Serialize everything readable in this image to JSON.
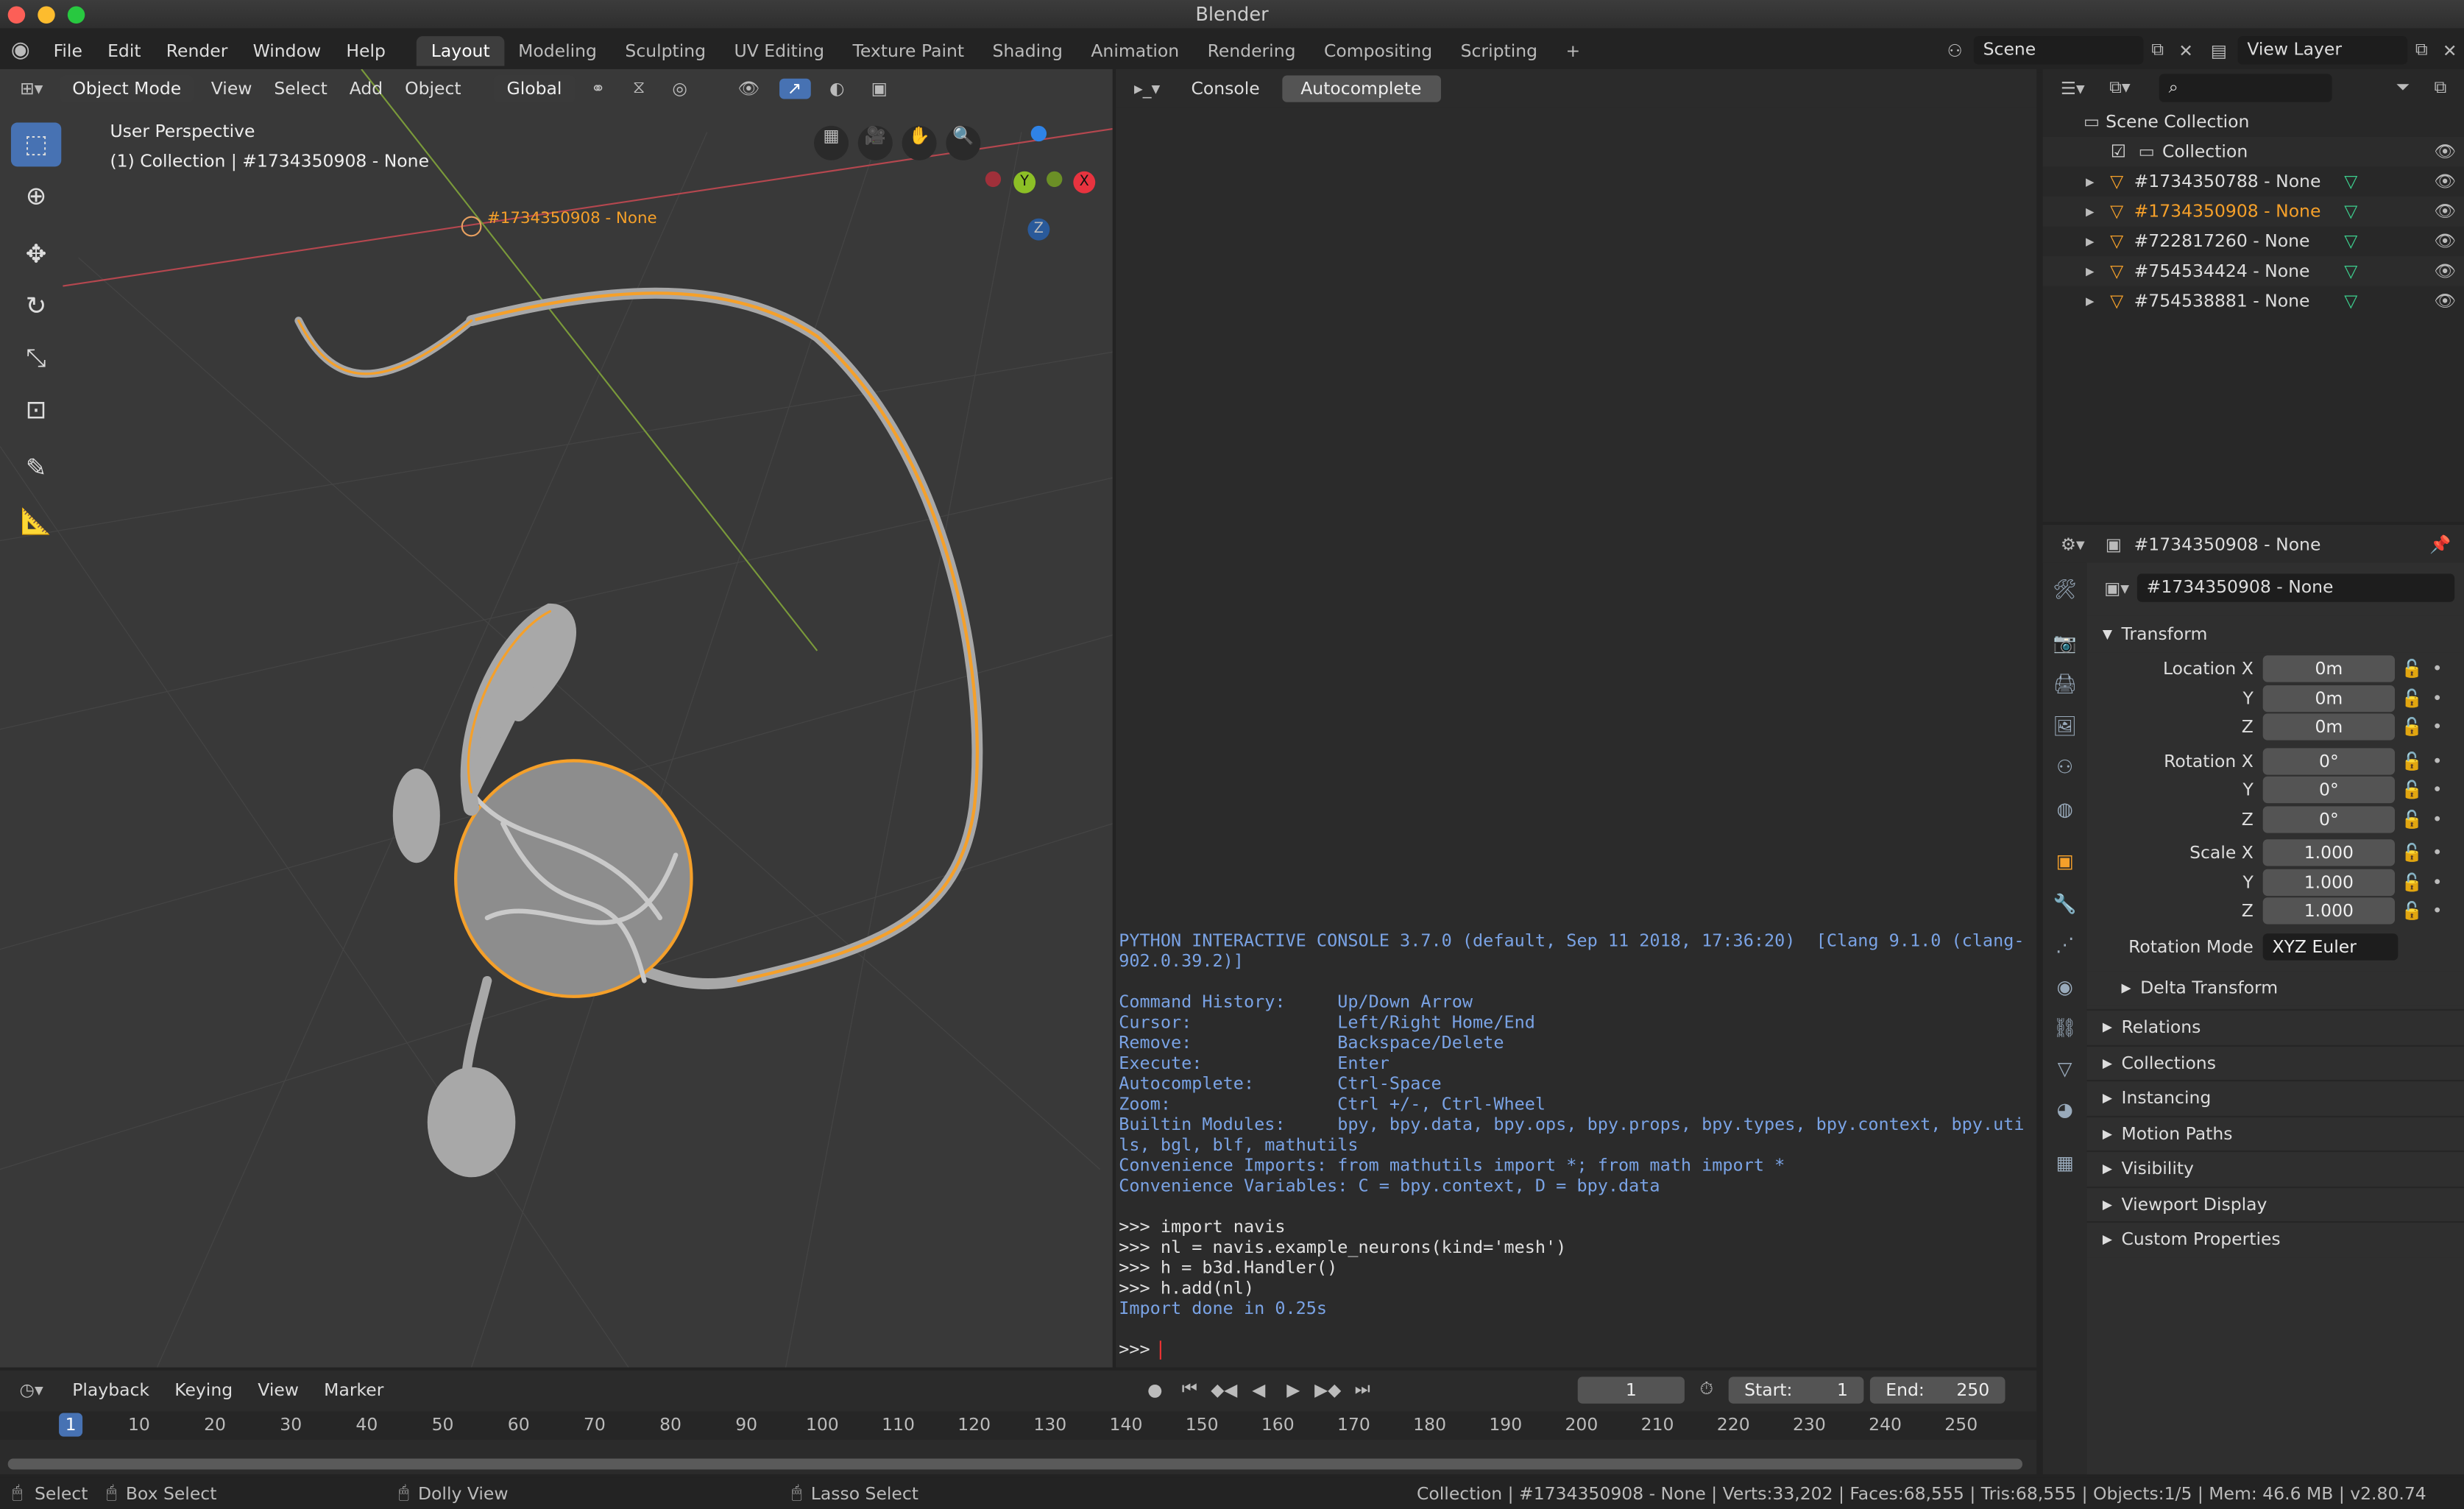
{
  "window": {
    "title": "Blender"
  },
  "menu": [
    "File",
    "Edit",
    "Render",
    "Window",
    "Help"
  ],
  "workspaces": [
    "Layout",
    "Modeling",
    "Sculpting",
    "UV Editing",
    "Texture Paint",
    "Shading",
    "Animation",
    "Rendering",
    "Compositing",
    "Scripting",
    "+"
  ],
  "active_workspace": "Layout",
  "scene": {
    "name": "Scene",
    "view_layer": "View Layer"
  },
  "viewport": {
    "mode": "Object Mode",
    "menus": [
      "View",
      "Select",
      "Add",
      "Object"
    ],
    "orientation": "Global",
    "overlay_title": "User Perspective",
    "overlay_sub": "(1) Collection | #1734350908 - None",
    "object_label": "#1734350908 - None",
    "gizmo": {
      "x": "X",
      "y": "Y",
      "z": "Z"
    },
    "colors": {
      "neuron": "#f5a02a",
      "mesh": "#a8a8a8",
      "x_axis": "#b5474f",
      "y_axis": "#7a9a3a"
    }
  },
  "console": {
    "tabs": [
      "Console",
      "Autocomplete"
    ],
    "lines": [
      {
        "t": "PYTHON INTERACTIVE CONSOLE 3.7.0 (default, Sep 11 2018, 17:36:20)  [Clang 9.1.0 (clang-",
        "c": "info"
      },
      {
        "t": "902.0.39.2)]",
        "c": "info"
      },
      {
        "t": "",
        "c": "info"
      },
      {
        "t": "Command History:     Up/Down Arrow",
        "c": "info"
      },
      {
        "t": "Cursor:              Left/Right Home/End",
        "c": "info"
      },
      {
        "t": "Remove:              Backspace/Delete",
        "c": "info"
      },
      {
        "t": "Execute:             Enter",
        "c": "info"
      },
      {
        "t": "Autocomplete:        Ctrl-Space",
        "c": "info"
      },
      {
        "t": "Zoom:                Ctrl +/-, Ctrl-Wheel",
        "c": "info"
      },
      {
        "t": "Builtin Modules:     bpy, bpy.data, bpy.ops, bpy.props, bpy.types, bpy.context, bpy.uti",
        "c": "info"
      },
      {
        "t": "ls, bgl, blf, mathutils",
        "c": "info"
      },
      {
        "t": "Convenience Imports: from mathutils import *; from math import *",
        "c": "info"
      },
      {
        "t": "Convenience Variables: C = bpy.context, D = bpy.data",
        "c": "info"
      },
      {
        "t": "",
        "c": "info"
      },
      {
        "t": ">>> import navis",
        "c": "cmd"
      },
      {
        "t": ">>> nl = navis.example_neurons(kind='mesh')",
        "c": "cmd"
      },
      {
        "t": ">>> h = b3d.Handler()",
        "c": "cmd"
      },
      {
        "t": ">>> h.add(nl)",
        "c": "cmd"
      },
      {
        "t": "Import done in 0.25s",
        "c": "info"
      },
      {
        "t": "",
        "c": "info"
      },
      {
        "t": ">>> ",
        "c": "cmd"
      }
    ]
  },
  "outliner": {
    "root": "Scene Collection",
    "collection": "Collection",
    "objects": [
      {
        "name": "#1734350788 - None",
        "selected": false
      },
      {
        "name": "#1734350908 - None",
        "selected": true
      },
      {
        "name": "#722817260 - None",
        "selected": false
      },
      {
        "name": "#754534424 - None",
        "selected": false
      },
      {
        "name": "#754538881 - None",
        "selected": false
      }
    ]
  },
  "properties": {
    "header": "#1734350908 - None",
    "object_name": "#1734350908 - None",
    "transform_title": "Transform",
    "rows": [
      {
        "label": "Location X",
        "value": "0m"
      },
      {
        "label": "Y",
        "value": "0m"
      },
      {
        "label": "Z",
        "value": "0m"
      },
      {
        "label": "Rotation X",
        "value": "0°"
      },
      {
        "label": "Y",
        "value": "0°"
      },
      {
        "label": "Z",
        "value": "0°"
      },
      {
        "label": "Scale X",
        "value": "1.000"
      },
      {
        "label": "Y",
        "value": "1.000"
      },
      {
        "label": "Z",
        "value": "1.000"
      }
    ],
    "rotation_mode_label": "Rotation Mode",
    "rotation_mode": "XYZ Euler",
    "delta": "Delta Transform",
    "panels": [
      "Relations",
      "Collections",
      "Instancing",
      "Motion Paths",
      "Visibility",
      "Viewport Display",
      "Custom Properties"
    ]
  },
  "timeline": {
    "menus": [
      "Playback",
      "Keying",
      "View",
      "Marker"
    ],
    "current_frame": "1",
    "start_label": "Start:",
    "start": "1",
    "end_label": "End:",
    "end": "250",
    "ticks": [
      "1",
      "10",
      "20",
      "30",
      "40",
      "50",
      "60",
      "70",
      "80",
      "90",
      "100",
      "110",
      "120",
      "130",
      "140",
      "150",
      "160",
      "170",
      "180",
      "190",
      "200",
      "210",
      "220",
      "230",
      "240",
      "250"
    ]
  },
  "statusbar": {
    "select": "Select",
    "box_select": "Box Select",
    "dolly": "Dolly View",
    "lasso": "Lasso Select",
    "info": "Collection | #1734350908 - None | Verts:33,202 | Faces:68,555 | Tris:68,555 | Objects:1/5 | Mem: 46.6 MB | v2.80.74"
  }
}
